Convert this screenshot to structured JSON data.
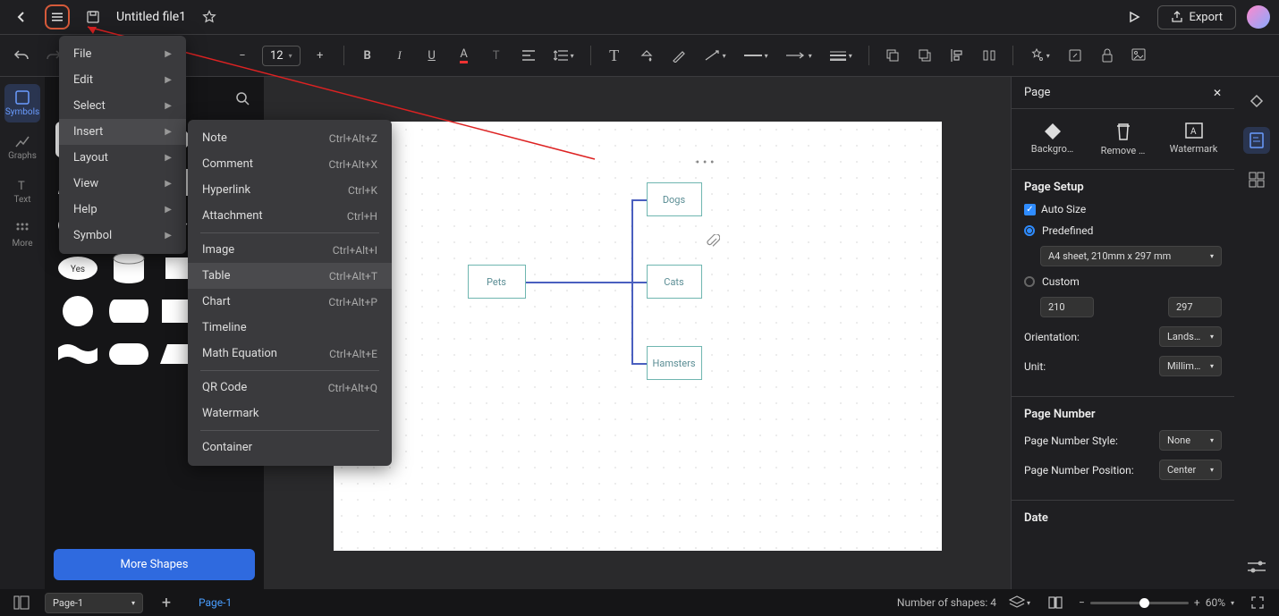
{
  "topbar": {
    "filename": "Untitled file1",
    "export_label": "Export"
  },
  "toolbar": {
    "font_size": "12"
  },
  "leftrail": {
    "items": [
      {
        "label": "Symbols"
      },
      {
        "label": "Graphs"
      },
      {
        "label": "Text"
      },
      {
        "label": "More"
      }
    ]
  },
  "shapes_panel": {
    "more_shapes_label": "More Shapes"
  },
  "main_menu": {
    "items": [
      {
        "label": "File",
        "sub": true
      },
      {
        "label": "Edit",
        "sub": true
      },
      {
        "label": "Select",
        "sub": true
      },
      {
        "label": "Insert",
        "sub": true,
        "hovered": true
      },
      {
        "label": "Layout",
        "sub": true
      },
      {
        "label": "View",
        "sub": true
      },
      {
        "label": "Help",
        "sub": true
      },
      {
        "label": "Symbol",
        "sub": true
      }
    ]
  },
  "insert_submenu": {
    "items": [
      {
        "label": "Note",
        "shortcut": "Ctrl+Alt+Z"
      },
      {
        "label": "Comment",
        "shortcut": "Ctrl+Alt+X"
      },
      {
        "label": "Hyperlink",
        "shortcut": "Ctrl+K"
      },
      {
        "label": "Attachment",
        "shortcut": "Ctrl+H"
      },
      {
        "sep": true
      },
      {
        "label": "Image",
        "shortcut": "Ctrl+Alt+I"
      },
      {
        "label": "Table",
        "shortcut": "Ctrl+Alt+T",
        "hovered": true
      },
      {
        "label": "Chart",
        "shortcut": "Ctrl+Alt+P"
      },
      {
        "label": "Timeline",
        "shortcut": ""
      },
      {
        "label": "Math Equation",
        "shortcut": "Ctrl+Alt+E"
      },
      {
        "sep": true
      },
      {
        "label": "QR Code",
        "shortcut": "Ctrl+Alt+Q"
      },
      {
        "label": "Watermark",
        "shortcut": ""
      },
      {
        "sep": true
      },
      {
        "label": "Container",
        "shortcut": ""
      }
    ]
  },
  "canvas": {
    "nodes": {
      "root": "Pets",
      "child1": "Dogs",
      "child2": "Cats",
      "child3": "Hamsters"
    }
  },
  "rightpanel": {
    "title": "Page",
    "icons": {
      "background": "Backgro…",
      "remove": "Remove …",
      "watermark": "Watermark"
    },
    "page_setup": {
      "heading": "Page Setup",
      "auto_size": "Auto Size",
      "predefined": "Predefined",
      "preset_value": "A4 sheet, 210mm x 297 mm",
      "custom": "Custom",
      "width": "210",
      "height": "297",
      "orientation_label": "Orientation:",
      "orientation_value": "Lands…",
      "unit_label": "Unit:",
      "unit_value": "Millim…"
    },
    "page_number": {
      "heading": "Page Number",
      "style_label": "Page Number Style:",
      "style_value": "None",
      "position_label": "Page Number Position:",
      "position_value": "Center"
    },
    "date_heading": "Date"
  },
  "bottombar": {
    "page_selector": "Page-1",
    "page_tab": "Page-1",
    "shapes_count": "Number of shapes: 4",
    "zoom": "60%"
  }
}
